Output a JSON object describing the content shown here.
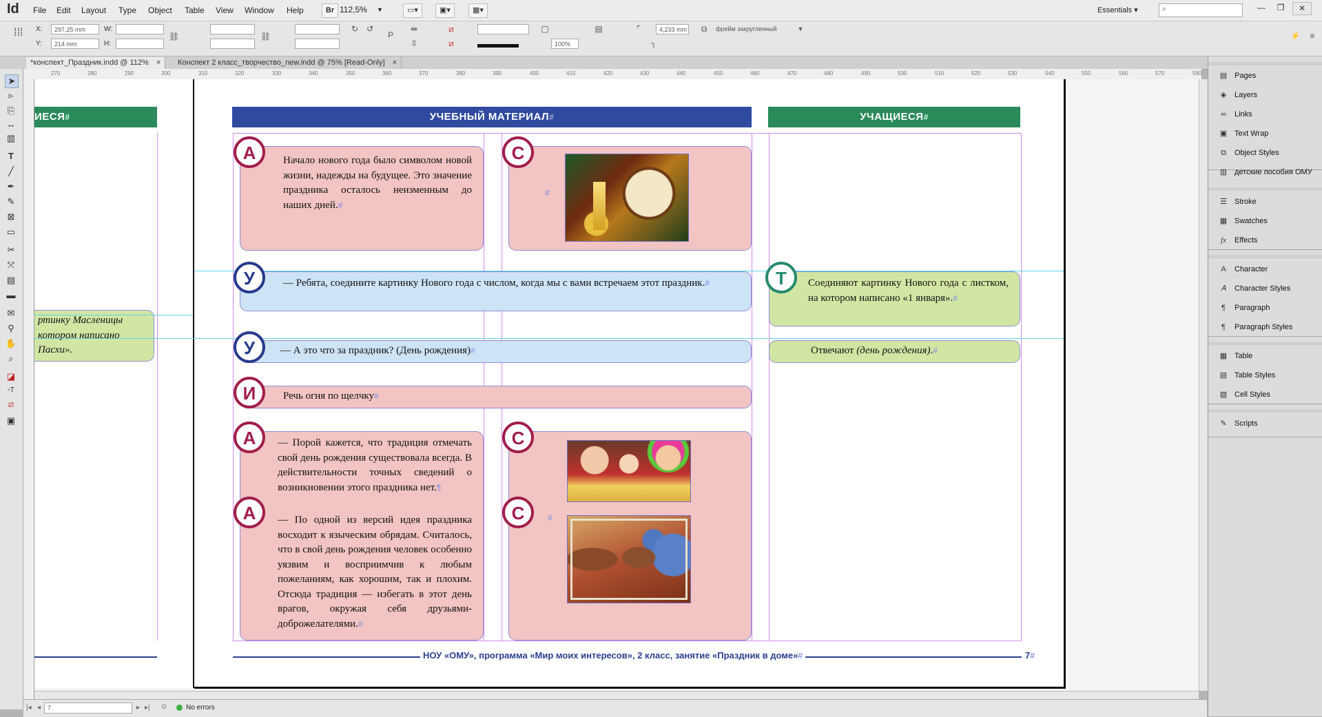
{
  "app": {
    "logo": "Id",
    "menus": [
      "File",
      "Edit",
      "Layout",
      "Type",
      "Object",
      "Table",
      "View",
      "Window",
      "Help"
    ],
    "bridge_label": "Br",
    "zoom": "112,5%",
    "workspace": "Essentials"
  },
  "control": {
    "x_label": "X:",
    "x_value": "297,25 mm",
    "y_label": "Y:",
    "y_value": "214 mm",
    "w_label": "W:",
    "h_label": "H:",
    "stroke_weight": "4,233 mm",
    "scale_percent": "100%",
    "object_style": "фрейм закругленный"
  },
  "tabs": [
    {
      "label": "*конспект_Праздник.indd @ 112%",
      "active": true
    },
    {
      "label": "Конспект 2 класс_творчество_new.indd @ 75% [Read-Only]",
      "active": false
    }
  ],
  "ruler_top": [
    "270",
    "280",
    "290",
    "300",
    "310",
    "320",
    "330",
    "340",
    "350",
    "360",
    "370",
    "380",
    "390",
    "400",
    "410",
    "420",
    "430",
    "440",
    "450",
    "460",
    "470",
    "480",
    "490",
    "500",
    "510",
    "520",
    "530",
    "540",
    "550",
    "560",
    "570",
    "580"
  ],
  "status": {
    "page": "7",
    "errors": "No errors"
  },
  "panels": {
    "group1": [
      {
        "label": "Pages",
        "icon": "pages-icon"
      },
      {
        "label": "Layers",
        "icon": "layers-icon"
      },
      {
        "label": "Links",
        "icon": "links-icon"
      },
      {
        "label": "Text Wrap",
        "icon": "text-wrap-icon"
      },
      {
        "label": "Object Styles",
        "icon": "object-styles-icon"
      },
      {
        "label": "детские пособия ОМУ",
        "icon": "library-icon"
      }
    ],
    "group2": [
      {
        "label": "Stroke",
        "icon": "stroke-icon"
      },
      {
        "label": "Swatches",
        "icon": "swatches-icon"
      },
      {
        "label": "Effects",
        "icon": "effects-icon"
      }
    ],
    "group3": [
      {
        "label": "Character",
        "icon": "character-icon"
      },
      {
        "label": "Character Styles",
        "icon": "character-styles-icon"
      },
      {
        "label": "Paragraph",
        "icon": "paragraph-icon"
      },
      {
        "label": "Paragraph Styles",
        "icon": "paragraph-styles-icon"
      }
    ],
    "group4": [
      {
        "label": "Table",
        "icon": "table-icon"
      },
      {
        "label": "Table Styles",
        "icon": "table-styles-icon"
      },
      {
        "label": "Cell Styles",
        "icon": "cell-styles-icon"
      }
    ],
    "group5": [
      {
        "label": "Scripts",
        "icon": "scripts-icon"
      }
    ]
  },
  "doc": {
    "left_header": "ИЕСЯ",
    "left_text_1": "ртинку  Масленицы",
    "left_text_2": "котором  написано",
    "left_text_3": "Пасхи».",
    "header_main": "УЧЕБНЫЙ МАТЕРИАЛ",
    "header_students": "УЧАЩИЕСЯ",
    "block1_badge": "А",
    "block1_text": "Начало нового года было символом новой жизни, надежды на будущее. Это значение праздника осталось неизменным до наших дней.",
    "block2_badge": "С",
    "block3_badge": "У",
    "block3_text": "— Ребята, соедините картинку Нового года с числом, когда мы с вами встречаем этот праздник.",
    "block3_student_badge": "Т",
    "block3_student_text": "Соединяют картинку Нового года с листком, на котором написано «1 января».",
    "block4_badge": "У",
    "block4_text": "— А это что за праздник? (День рождения)",
    "block4_student_prefix": "Отвечают ",
    "block4_student_italic": "(день рождения)",
    "block4_student_suffix": ".",
    "block5_badge": "И",
    "block5_text": "Речь огня по щелчку",
    "block6_badge": "А",
    "block6_text": "— Порой кажется, что традиция отмечать свой день рождения существовала всегда. В действительности точных сведений о возникновении этого праздника нет.",
    "block7_badge": "А",
    "block7_text": "— По одной из версий идея праздника восходит к языческим обрядам. Считалось, что в свой день рождения человек особенно уязвим и восприимчив к любым пожеланиям, как хорошим, так и плохим. Отсюда традиция — избегать в этот день врагов, окружая себя друзьями-доброжелателями.",
    "block8_badge": "С",
    "block9_badge": "С",
    "footer": "НОУ «ОМУ», программа «Мир моих интересов», 2 класс, занятие «Праздник в доме»",
    "page_number": "7"
  },
  "colors": {
    "header_blue": "#2f4a9e",
    "header_green": "#2a8a5a",
    "badge_red": "#a01e4a",
    "badge_navy": "#283a8c",
    "badge_teal": "#268a70"
  }
}
